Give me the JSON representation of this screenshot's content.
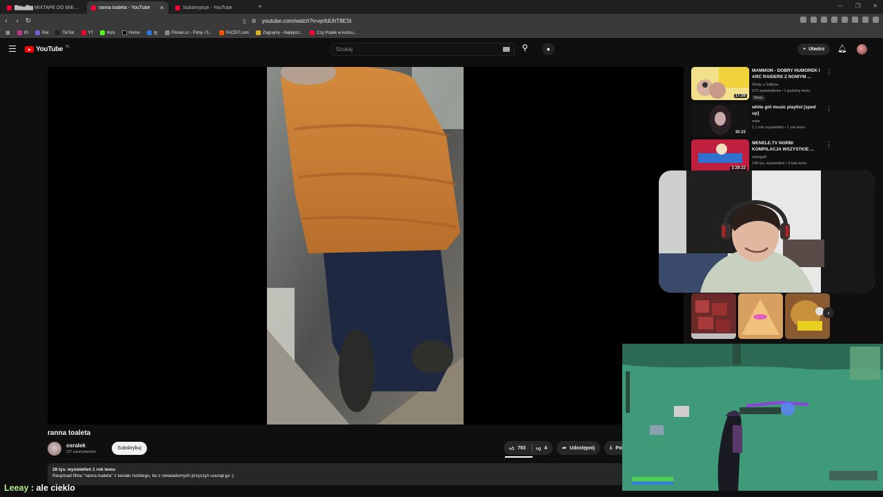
{
  "browser": {
    "tabs": [
      {
        "title": "▇▆▅▇▆ MIXTAPE DO MIES...",
        "active": false
      },
      {
        "title": "ranna toaleta - YouTube",
        "active": true
      },
      {
        "title": "Subskrypcje - YouTube",
        "active": false
      }
    ],
    "url": "youtube.com/watch?v=qnfdUhT8ESI",
    "bookmarks": [
      "IG",
      "Rat",
      "TikTok",
      "YT",
      "Kick",
      "Home",
      "天",
      "Filman.cc - Filmy i S...",
      "FACEIT.com",
      "Zagrajmy - Najlepsz...",
      "Czy Popek w końcu..."
    ]
  },
  "youtube": {
    "logo": "YouTube",
    "country": "PL",
    "search_placeholder": "Szukaj",
    "create_label": "Utwórz"
  },
  "video": {
    "title": "ranna toaleta",
    "channel": "osralek",
    "subscribers": "227 subskrybentów",
    "subscribe_label": "Subskrybuj",
    "likes": "783",
    "dislikes": "4",
    "share_label": "Udostępnij",
    "download_label": "Pol",
    "views_time": "28 tys. wyświetleń  1 rok temu",
    "description": "Reupload filmu \"ranna toaleta\" z kanału norbiego, bo z niewiadomych przyczyn usunął go :("
  },
  "suggestions": [
    {
      "title": "MAMMON - DOBRY HUMOREK I ARC RAIDERS Z NOWYM ...",
      "channel": "Shoty u Sołtysa",
      "meta": "272 wyświetlenia • 1 godzinę temu",
      "duration": "17:26",
      "badge": "Nowy"
    },
    {
      "title": "white girl music playlist [sped up]",
      "channel": "solar",
      "meta": "1,1 mln wyświetleń • 1 rok temu",
      "duration": "30:23",
      "badge": ""
    },
    {
      "title": "MENELE.TV NORBI KOMPILACJA WSZYSTKIE ...",
      "channel": "mlazga8",
      "meta": "138 tys. wyświetleń • 3 lata temu",
      "duration": "3:29:23",
      "badge": ""
    }
  ],
  "chat": {
    "user": "Leeay",
    "message": " : ale cieklo"
  }
}
